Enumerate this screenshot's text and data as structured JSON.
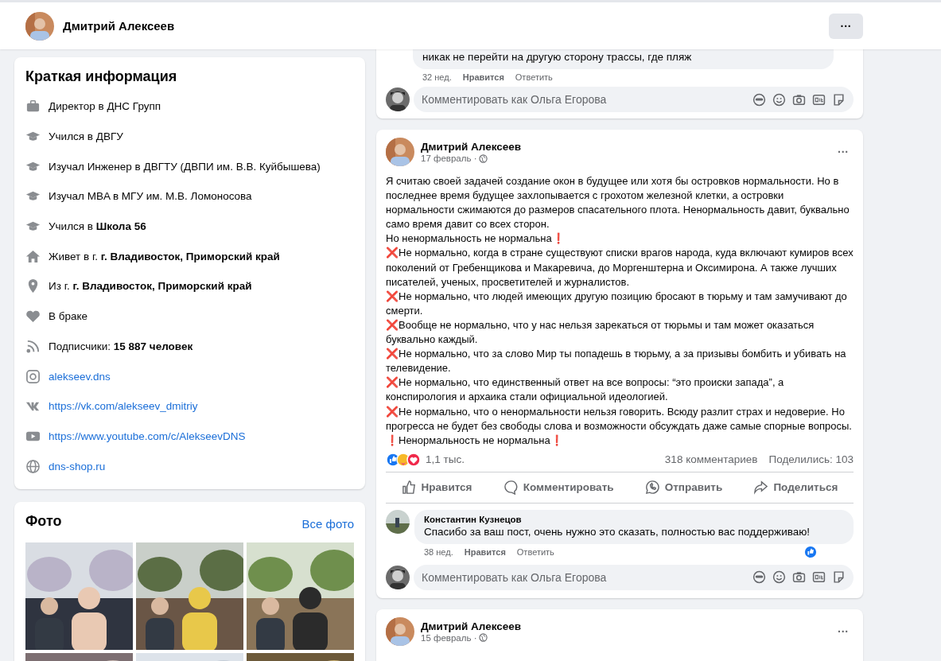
{
  "header": {
    "name": "Дмитрий Алексеев",
    "menu": "···"
  },
  "intro": {
    "title": "Краткая информация",
    "items": [
      {
        "kind": "work",
        "text": "Директор в ДНС Групп"
      },
      {
        "kind": "study",
        "text": "Учился в ДВГУ"
      },
      {
        "kind": "study",
        "text": "Изучал Инженер в ДВГТУ (ДВПИ им. В.В. Куйбышева)"
      },
      {
        "kind": "study",
        "text": "Изучал MBA в МГУ им. М.В. Ломоносова"
      },
      {
        "kind": "study",
        "text": "Учился в **Школа 56**"
      },
      {
        "kind": "home",
        "text": "Живет в г. **г. Владивосток, Приморский край**"
      },
      {
        "kind": "pin",
        "text": "Из г. **г. Владивосток, Приморский край**"
      },
      {
        "kind": "heart",
        "text": "В браке"
      },
      {
        "kind": "feed",
        "text": "Подписчики: **15 887 человек**"
      },
      {
        "kind": "instagram",
        "text": "alekseev.dns",
        "link": true
      },
      {
        "kind": "vk",
        "text": "https://vk.com/alekseev_dmitriy",
        "link": true
      },
      {
        "kind": "youtube",
        "text": "https://www.youtube.com/c/AlekseevDNS",
        "link": true
      },
      {
        "kind": "globe",
        "text": "dns-shop.ru",
        "link": true
      }
    ]
  },
  "photos": {
    "title": "Фото",
    "link": "Все фото"
  },
  "prev_post": {
    "comment_text": "никак не перейти на другую сторону трассы, где пляж",
    "time": "32 нед.",
    "like": "Нравится",
    "reply": "Ответить",
    "input_placeholder": "Комментировать как Ольга Егорова"
  },
  "post": {
    "author": "Дмитрий Алексеев",
    "date": "17 февраль ·",
    "menu": "···",
    "paragraphs": [
      {
        "text": "Я считаю своей задачей создание окон в будущее или хотя бы островков нормальности. Но в последнее время будущее захлопывается с грохотом железной клетки, а островки нормальности сжимаются до размеров спасательного плота. Ненормальность давит, буквально само время давит со всех сторон."
      },
      {
        "text": "Но ненормальность не нормальна",
        "suffix": "❗"
      },
      {
        "prefix": "❌",
        "text": "Не нормально, когда в стране существуют списки врагов народа, куда включают кумиров всех поколений от Гребенщикова и Макаревича, до Моргенштерна и Оксимирона. А также лучших писателей, ученых, просветителей и журналистов."
      },
      {
        "prefix": "❌",
        "text": "Не нормально, что людей имеющих другую позицию бросают в тюрьму и там замучивают до смерти."
      },
      {
        "prefix": "❌",
        "text": "Вообще не нормально, что у нас нельзя зарекаться от тюрьмы и там может оказаться буквально каждый."
      },
      {
        "prefix": "❌",
        "text": "Не нормально, что за слово Мир ты попадешь в тюрьму, а за призывы бомбить и убивать на телевидение."
      },
      {
        "prefix": "❌",
        "text": "Не нормально, что единственный ответ на все вопросы: “это происки запада”, а конспирология и архаика стали официальной идеологией."
      },
      {
        "prefix": "❌",
        "text": "Не нормально, что о ненормальности нельзя говорить. Всюду разлит страх и недоверие. Но прогресса не будет без свободы слова и возможности обсуждать даже самые спорные вопросы."
      },
      {
        "prefix": "❗",
        "text": "Ненормальность не нормальна",
        "suffix": "❗"
      }
    ],
    "reactions": "1,1 тыс.",
    "comments": "318 комментариев",
    "shares": "Поделились: 103",
    "actions": [
      {
        "kind": "like",
        "label": "Нравится"
      },
      {
        "kind": "comment",
        "label": "Комментировать"
      },
      {
        "kind": "send",
        "label": "Отправить"
      },
      {
        "kind": "share",
        "label": "Поделиться"
      }
    ],
    "comment": {
      "author": "Константин Кузнецов",
      "text": "Спасибо за ваш пост, очень нужно это сказать, полностью вас поддерживаю!",
      "time": "38 нед.",
      "like": "Нравится",
      "reply": "Ответить"
    },
    "input_placeholder": "Комментировать как Ольга Егорова"
  },
  "next_post": {
    "author": "Дмитрий Алексеев",
    "date": "15 февраль ·",
    "menu": "···"
  }
}
